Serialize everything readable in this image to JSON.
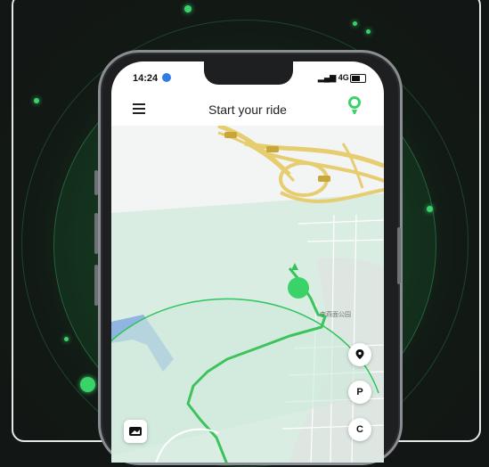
{
  "status_bar": {
    "time": "14:24",
    "network": "4G"
  },
  "header": {
    "title": "Start your ride"
  },
  "map": {
    "place_label": "李燕面公园",
    "road_badges": [
      "G15",
      "G15",
      "G15"
    ]
  },
  "map_controls": {
    "parking_label": "P",
    "center_label": "C"
  },
  "icons": [
    "menu-icon",
    "support-icon",
    "location-icon",
    "parking-icon",
    "recenter-icon",
    "layers-icon"
  ],
  "colors": {
    "accent": "#3ad36a",
    "route": "#2ec45c",
    "zone_fill": "#d5ebe0"
  }
}
